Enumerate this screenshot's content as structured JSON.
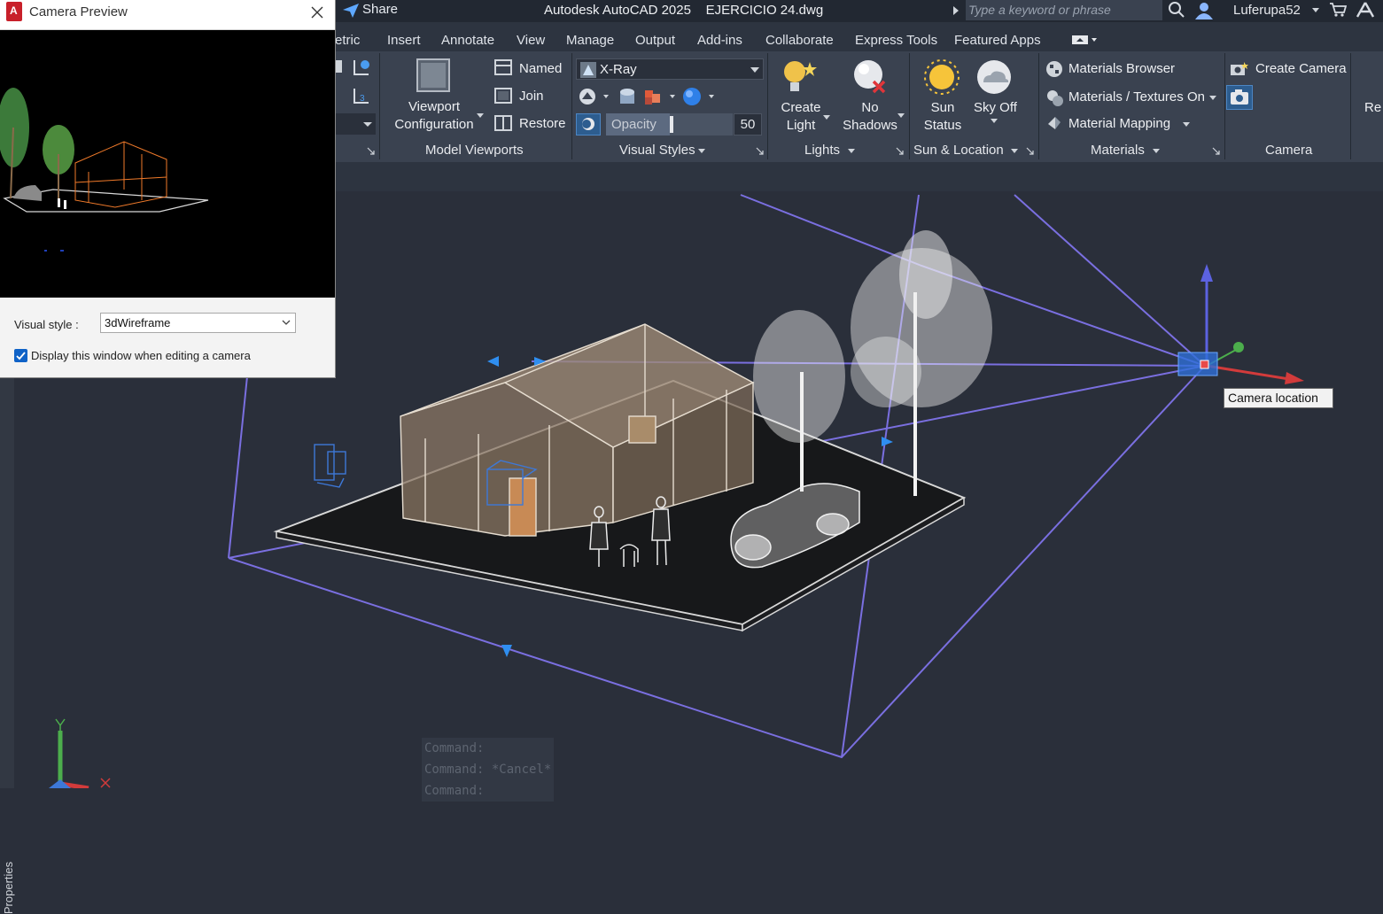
{
  "titlebar": {
    "share_label": "Share",
    "app_title": "Autodesk AutoCAD 2025    EJERCICIO 24.dwg",
    "search_placeholder": "Type a keyword or phrase",
    "username": "Luferupa52"
  },
  "tabs": [
    "etric",
    "Insert",
    "Annotate",
    "View",
    "Manage",
    "Output",
    "Add-ins",
    "Collaborate",
    "Express Tools",
    "Featured Apps"
  ],
  "ribbon": {
    "model_viewports": {
      "title": "Model Viewports",
      "viewport_config_line1": "Viewport",
      "viewport_config_line2": "Configuration",
      "named": "Named",
      "join": "Join",
      "restore": "Restore"
    },
    "visual_styles": {
      "title": "Visual Styles",
      "current_style": "X-Ray",
      "opacity_label": "Opacity",
      "opacity_value": "50"
    },
    "lights": {
      "title": "Lights",
      "create_light_line1": "Create",
      "create_light_line2": "Light",
      "no_shadows_line1": "No",
      "no_shadows_line2": "Shadows"
    },
    "sun_location": {
      "title": "Sun & Location",
      "sun_status_line1": "Sun",
      "sun_status_line2": "Status",
      "sky_off": "Sky Off"
    },
    "materials": {
      "title": "Materials",
      "browser": "Materials Browser",
      "textures": "Materials / Textures On",
      "mapping": "Material Mapping"
    },
    "camera": {
      "title": "Camera",
      "create_camera": "Create Camera",
      "overflow": "Re"
    }
  },
  "dialog": {
    "title": "Camera Preview",
    "visual_style_label": "Visual style :",
    "visual_style_value": "3dWireframe",
    "checkbox_label": "Display this window when editing a camera",
    "checkbox_checked": true
  },
  "viewport": {
    "tooltip": "Camera location",
    "properties_label": "Properties"
  },
  "command_history": [
    "Command:",
    "Command: *Cancel*",
    "Command:"
  ],
  "colors": {
    "frustum": "#7a6fe0",
    "accent_blue": "#2f8ef0",
    "canvas_bg": "#2a2f3a"
  }
}
